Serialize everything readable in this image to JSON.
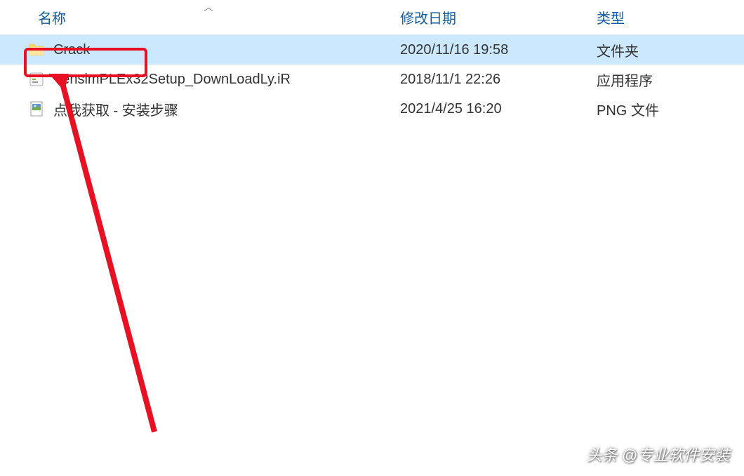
{
  "columns": {
    "name": "名称",
    "date": "修改日期",
    "type": "类型"
  },
  "files": [
    {
      "name": "Crack",
      "date": "2020/11/16 19:58",
      "type": "文件夹",
      "icon": "folder"
    },
    {
      "name": "VensimPLEx32Setup_DownLoadLy.iR",
      "date": "2018/11/1 22:26",
      "type": "应用程序",
      "icon": "exe"
    },
    {
      "name": "点我获取 - 安装步骤",
      "date": "2021/4/25 16:20",
      "type": "PNG 文件",
      "icon": "png"
    }
  ],
  "watermark": "头条 @专业软件安装"
}
